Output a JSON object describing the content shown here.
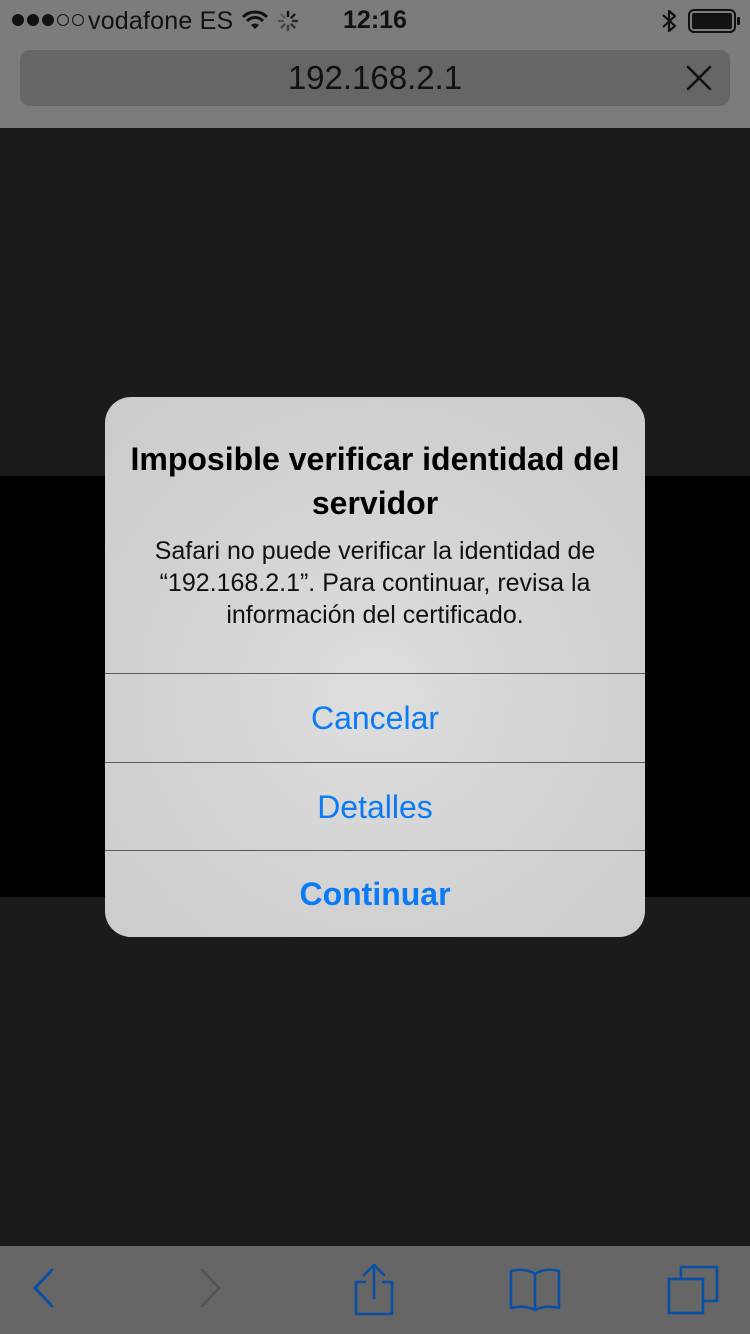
{
  "status_bar": {
    "carrier": "vodafone ES",
    "time": "12:16",
    "signal_bars_filled": 3,
    "signal_bars_total": 5
  },
  "url_bar": {
    "url": "192.168.2.1",
    "stop_icon": "close-icon"
  },
  "alert": {
    "title": "Imposible verificar identidad del servidor",
    "message": "Safari no puede verificar la identidad de “192.168.2.1”. Para continuar, revisa la información del certificado.",
    "buttons": {
      "cancel": "Cancelar",
      "details": "Detalles",
      "continue": "Continuar"
    },
    "accent_color": "#0a7af5"
  },
  "toolbar": {
    "icons": [
      "back-icon",
      "forward-icon",
      "share-icon",
      "bookmarks-icon",
      "tabs-icon"
    ]
  }
}
